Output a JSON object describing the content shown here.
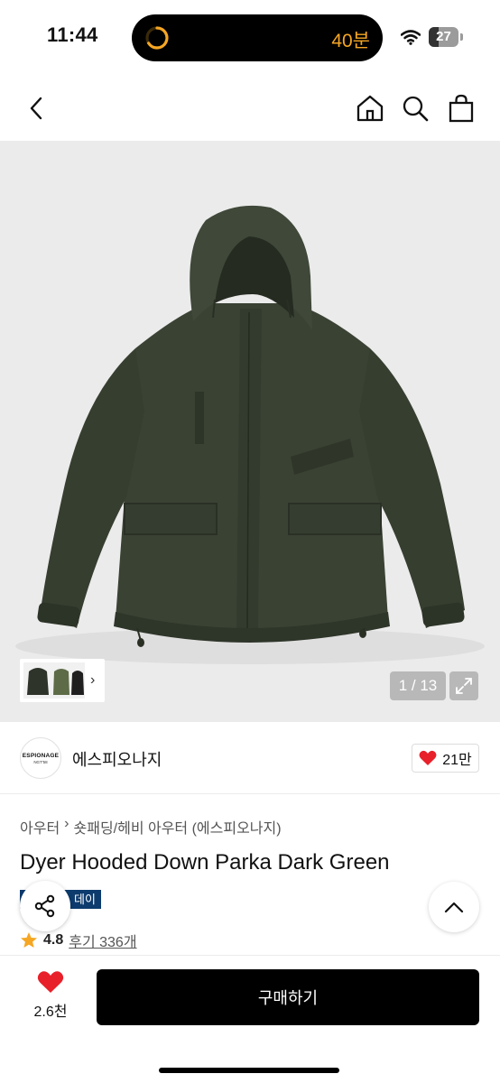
{
  "status_bar": {
    "time": "11:44",
    "activity": "40분",
    "battery_level": "27",
    "icons": {
      "wifi": "wifi-icon",
      "battery": "battery-icon",
      "timer": "timer-ring-icon"
    }
  },
  "nav": {
    "icons": {
      "back": "chevron-left-icon",
      "home": "home-icon",
      "search": "search-icon",
      "cart": "shopping-bag-icon"
    }
  },
  "gallery": {
    "current_page": "1",
    "total_pages": "13",
    "counter_text": "1 / 13",
    "thumb_chevron": "›",
    "icons": {
      "expand": "expand-icon"
    }
  },
  "brand": {
    "name": "에스피오나지",
    "logo_text": "ESPIONAGE",
    "logo_subtext": "NGT'58",
    "likes": "21만",
    "icons": {
      "like": "heart-icon"
    }
  },
  "product": {
    "breadcrumb": [
      "아우터",
      "숏패딩/헤비 아우터 (에스피오나지)"
    ],
    "breadcrumb_separator": "›",
    "title": "Dyer Hooded Down Parka Dark Green",
    "badge_text": "데이",
    "rating": "4.8",
    "reviews_label": "후기 336개",
    "icons": {
      "star": "star-icon",
      "share": "share-icon",
      "scroll_top": "chevron-up-icon"
    }
  },
  "bottom_bar": {
    "wish_count": "2.6천",
    "buy_label": "구매하기",
    "icons": {
      "wish": "heart-icon"
    }
  },
  "colors": {
    "accent_black": "#000000",
    "heart_red": "#e8202a",
    "star_orange": "#f5a623",
    "badge_blue": "#0d3b6e",
    "jacket_green": "#3a4234"
  }
}
